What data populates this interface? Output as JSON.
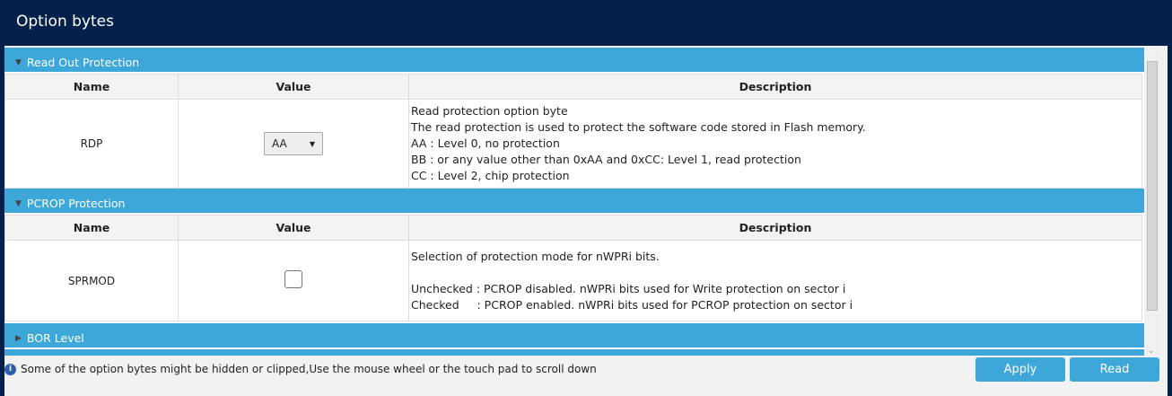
{
  "title": "Option bytes",
  "columns": {
    "name": "Name",
    "value": "Value",
    "description": "Description"
  },
  "sections": [
    {
      "label": "Read Out Protection",
      "expanded": true,
      "row": {
        "name": "RDP",
        "value": "AA",
        "description": "Read protection option byte\nThe read protection is used to protect the software code stored in Flash memory.\nAA : Level 0, no protection\nBB : or any value other than 0xAA and 0xCC: Level 1, read protection\nCC : Level 2, chip protection"
      }
    },
    {
      "label": "PCROP Protection",
      "expanded": true,
      "row": {
        "name": "SPRMOD",
        "checked": false,
        "description": "Selection of protection mode for nWPRi bits.\n\nUnchecked : PCROP disabled. nWPRi bits used for Write protection on sector i\nChecked     : PCROP enabled. nWPRi bits used for PCROP protection on sector i"
      }
    },
    {
      "label": "BOR Level",
      "expanded": false
    }
  ],
  "info": "Some of the option bytes might be hidden or clipped,Use the mouse wheel or the touch pad to scroll down",
  "buttons": {
    "apply": "Apply",
    "read": "Read"
  }
}
